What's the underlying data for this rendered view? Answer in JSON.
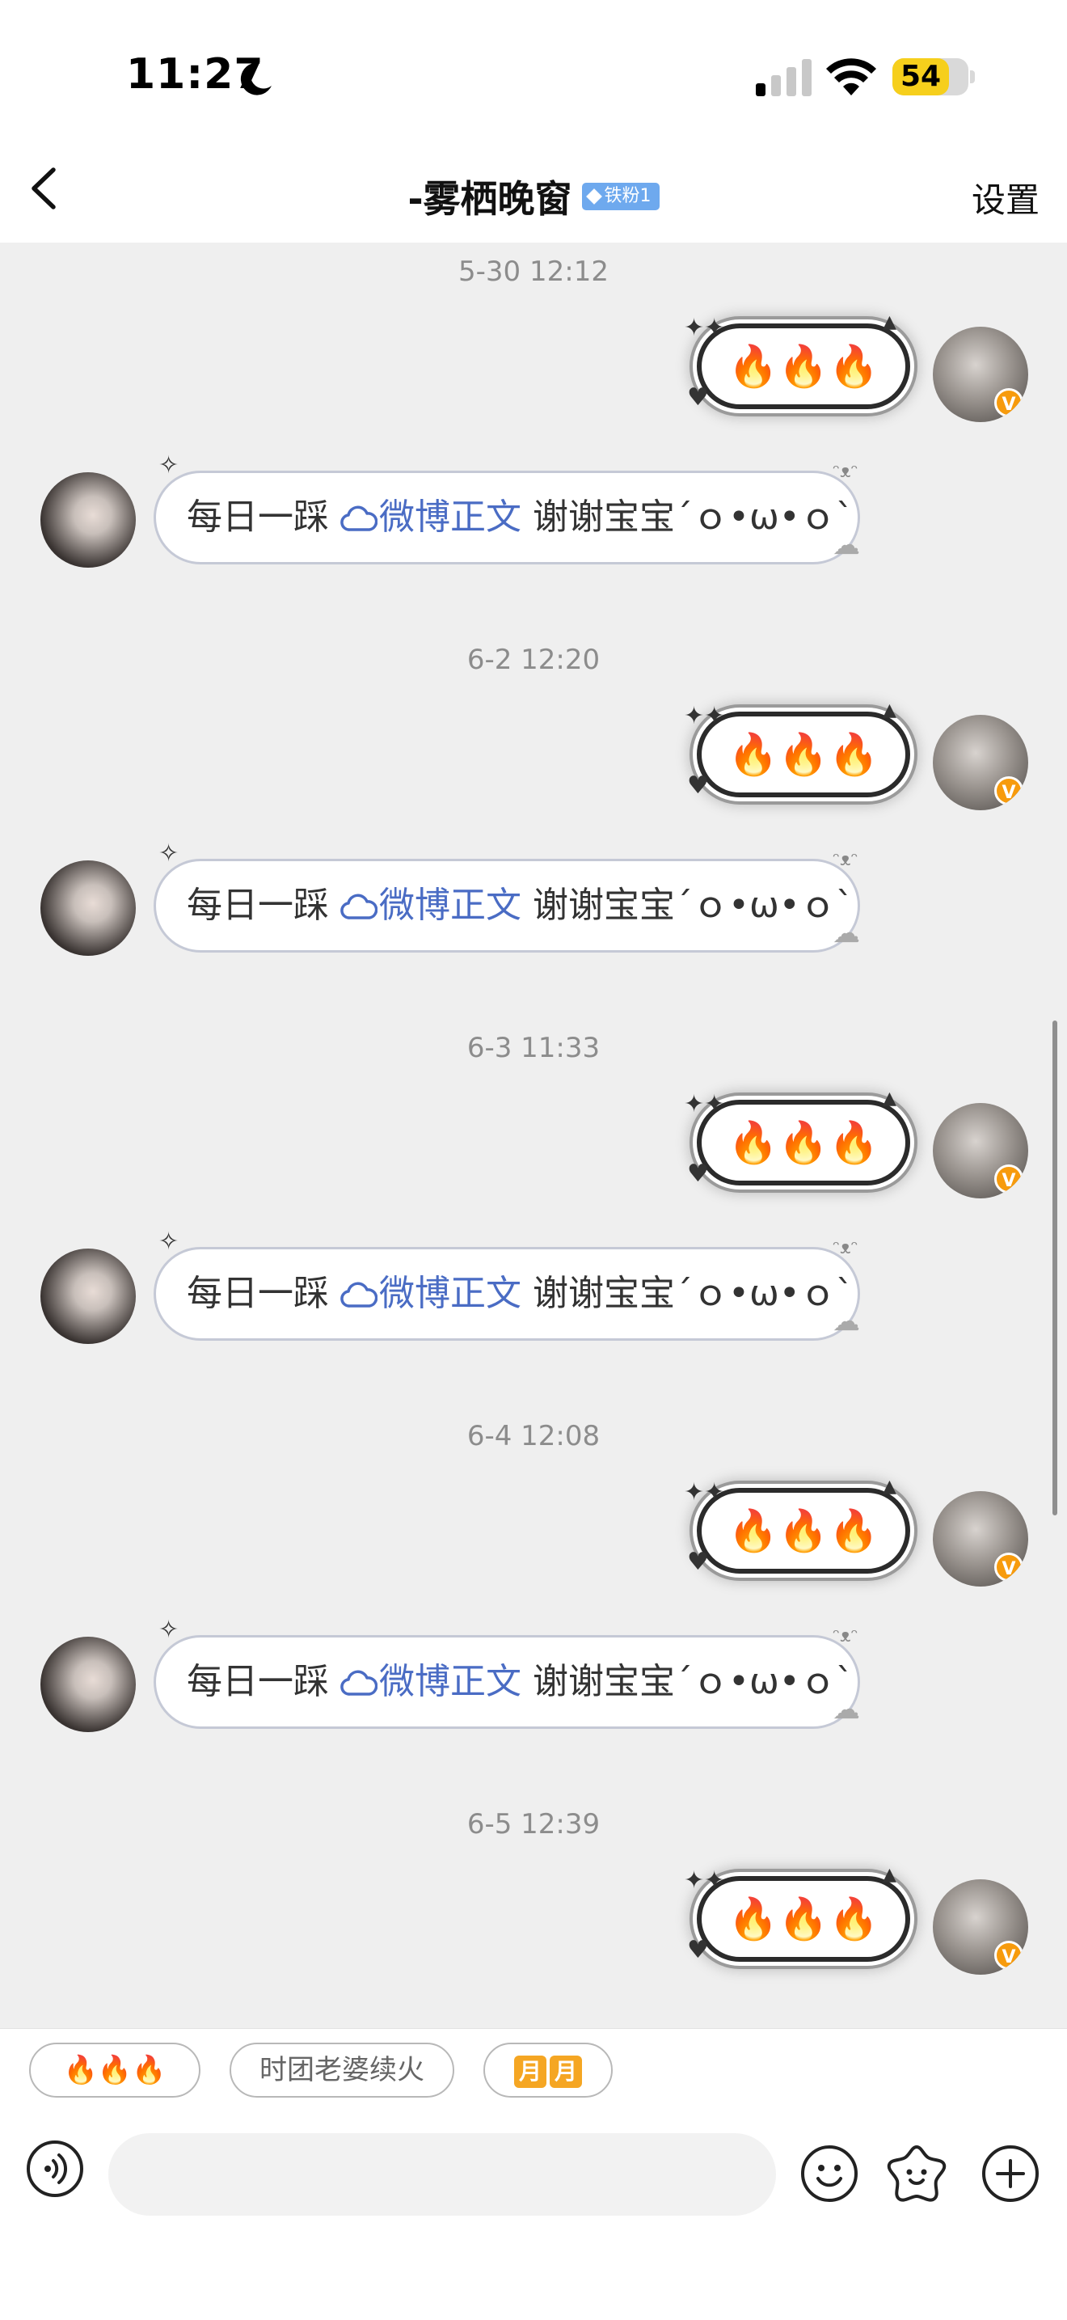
{
  "status_bar": {
    "time": "11:27",
    "battery_level": "54",
    "battery_color": "#f6cf1c",
    "icons": [
      "moon-icon",
      "signal-icon",
      "wifi-icon",
      "battery-icon"
    ]
  },
  "nav": {
    "title": "-雾栖晚窗",
    "fan_badge": "铁粉1",
    "settings_label": "设置",
    "back_icon": "chevron-left-icon"
  },
  "chat": {
    "messages": [
      {
        "timestamp": "5-30 12:12",
        "sent": "🔥🔥🔥",
        "received": {
          "prefix": "每日一踩",
          "link": "微博正文",
          "suffix": "谢谢宝宝",
          "kaomoji": "´ｏ•ω•ｏ`"
        }
      },
      {
        "timestamp": "6-2 12:20",
        "sent": "🔥🔥🔥",
        "received": {
          "prefix": "每日一踩",
          "link": "微博正文",
          "suffix": "谢谢宝宝",
          "kaomoji": "´ｏ•ω•ｏ`"
        }
      },
      {
        "timestamp": "6-3 11:33",
        "sent": "🔥🔥🔥",
        "received": {
          "prefix": "每日一踩",
          "link": "微博正文",
          "suffix": "谢谢宝宝",
          "kaomoji": "´ｏ•ω•ｏ`"
        }
      },
      {
        "timestamp": "6-4 12:08",
        "sent": "🔥🔥🔥",
        "received": {
          "prefix": "每日一踩",
          "link": "微博正文",
          "suffix": "谢谢宝宝",
          "kaomoji": "´ｏ•ω•ｏ`"
        }
      },
      {
        "timestamp": "6-5 12:39",
        "sent": "🔥🔥🔥"
      }
    ]
  },
  "quick_replies": {
    "fire": "🔥🔥🔥",
    "renew": "时团老婆续火",
    "moon_a": "月",
    "moon_b": "月"
  },
  "composer": {
    "input_value": "",
    "icons": [
      "voice-icon",
      "emoji-icon",
      "sticker-icon",
      "plus-icon"
    ]
  },
  "colors": {
    "link": "#4a6cc4",
    "chat_background": "#efefef",
    "vip_badge": "#f79b0d",
    "fan_badge": "#6ea9ee"
  }
}
